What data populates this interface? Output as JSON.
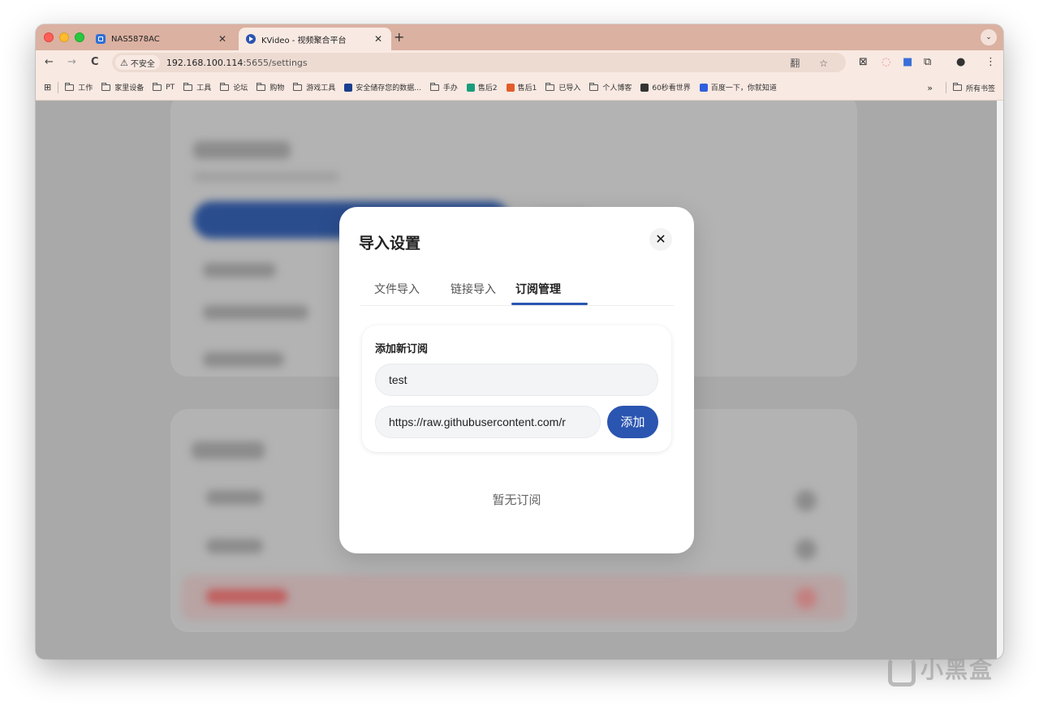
{
  "browser": {
    "tabs": [
      {
        "title": "NAS5878AC",
        "close": "✕"
      },
      {
        "title": "KVideo - 视频聚合平台",
        "close": "✕"
      }
    ],
    "new_tab": "+",
    "tab_menu": "⌄",
    "nav": {
      "back": "←",
      "forward": "→",
      "reload": "C"
    },
    "security_label": "不安全",
    "security_icon": "⚠",
    "url_host": "192.168.100.114",
    "url_path": ":5655/settings",
    "omnibox_icons": "翻 ☆",
    "bookmarks": [
      {
        "label": "工作",
        "type": "folder"
      },
      {
        "label": "家里设备",
        "type": "folder"
      },
      {
        "label": "PT",
        "type": "folder"
      },
      {
        "label": "工具",
        "type": "folder"
      },
      {
        "label": "论坛",
        "type": "folder"
      },
      {
        "label": "购物",
        "type": "folder"
      },
      {
        "label": "游戏工具",
        "type": "folder"
      },
      {
        "label": "安全储存您的数据...",
        "type": "site",
        "color": "#1a3f8f"
      },
      {
        "label": "手办",
        "type": "folder"
      },
      {
        "label": "售后2",
        "type": "site",
        "color": "#1a9c7c"
      },
      {
        "label": "售后1",
        "type": "site",
        "color": "#e25c2b"
      },
      {
        "label": "已导入",
        "type": "folder"
      },
      {
        "label": "个人博客",
        "type": "folder"
      },
      {
        "label": "60秒看世界",
        "type": "site",
        "color": "#333333"
      },
      {
        "label": "百度一下，你就知道",
        "type": "site",
        "color": "#2f5fdd"
      }
    ],
    "bookmarks_more": "»",
    "all_bookmarks": "所有书签"
  },
  "modal": {
    "title": "导入设置",
    "close": "✕",
    "tabs": [
      {
        "label": "文件导入",
        "active": false
      },
      {
        "label": "链接导入",
        "active": false
      },
      {
        "label": "订阅管理",
        "active": true
      }
    ],
    "add_section": {
      "title": "添加新订阅",
      "name_value": "test",
      "url_value": "https://raw.githubusercontent.com/r",
      "add_button": "添加"
    },
    "empty_text": "暂无订阅"
  },
  "watermark": "小黑盒",
  "colors": {
    "accent": "#2a55b0",
    "tabstrip": "#dbb1a1",
    "toolbar": "#f8e9e2",
    "overlay": "#a9a9a9"
  }
}
